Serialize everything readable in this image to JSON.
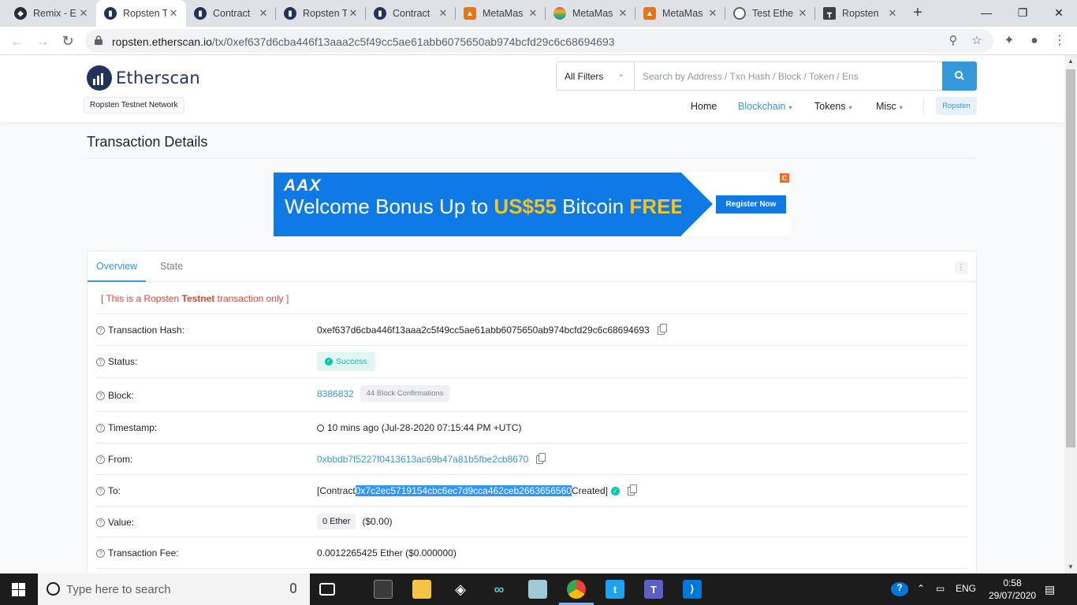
{
  "browser": {
    "tabs": [
      {
        "title": "Remix - E",
        "icon": "remix-icon",
        "color": "#2b2b2b"
      },
      {
        "title": "Ropsten T",
        "icon": "etherscan-icon",
        "color": "#21325b"
      },
      {
        "title": "Contract",
        "icon": "etherscan-icon",
        "color": "#21325b"
      },
      {
        "title": "Ropsten T",
        "icon": "etherscan-icon",
        "color": "#21325b"
      },
      {
        "title": "Contract",
        "icon": "etherscan-icon",
        "color": "#21325b"
      },
      {
        "title": "MetaMas",
        "icon": "metamask-icon",
        "color": "#e2761b"
      },
      {
        "title": "MetaMas",
        "icon": "rainbow-icon",
        "color": "#e04b4b"
      },
      {
        "title": "MetaMas",
        "icon": "metamask-icon",
        "color": "#e2761b"
      },
      {
        "title": "Test Ethe",
        "icon": "globe-icon",
        "color": "#5f6368"
      },
      {
        "title": "Ropsten",
        "icon": "faucet-icon",
        "color": "#3c4043"
      }
    ],
    "active_tab": 1,
    "url_host": "ropsten.etherscan.io",
    "url_path": "/tx/0xef637d6cba446f13aaa2c5f49cc5ae61abb6075650ab974bcfd29c6c68694693"
  },
  "site": {
    "logo_text": "Etherscan",
    "network_badge": "Ropsten Testnet Network",
    "search_filter": "All Filters",
    "search_placeholder": "Search by Address / Txn Hash / Block / Token / Ens",
    "nav": [
      "Home",
      "Blockchain",
      "Tokens",
      "Misc"
    ],
    "network_button": "Ropsten",
    "accent_color": "#3498db"
  },
  "page": {
    "title": "Transaction Details"
  },
  "ad": {
    "brand": "AAX",
    "headline_pre": "Welcome Bonus Up to ",
    "headline_amount": "US$55",
    "headline_mid": " Bitcoin ",
    "headline_free": "FREE",
    "cta": "Register Now",
    "corner": "C"
  },
  "card": {
    "tabs": [
      "Overview",
      "State"
    ],
    "notice_pre": "[ This is a Ropsten ",
    "notice_bold": "Testnet",
    "notice_post": " transaction only ]",
    "labels": {
      "hash": "Transaction Hash:",
      "status": "Status:",
      "block": "Block:",
      "timestamp": "Timestamp:",
      "from": "From:",
      "to": "To:",
      "value": "Value:",
      "fee": "Transaction Fee:"
    },
    "values": {
      "hash": "0xef637d6cba446f13aaa2c5f49cc5ae61abb6075650ab974bcfd29c6c68694693",
      "status": "Success",
      "block": "8386832",
      "confirmations": "44 Block Confirmations",
      "timestamp": "10 mins ago (Jul-28-2020 07:15:44 PM +UTC)",
      "from": "0xbbdb7f5227f0413613ac69b47a81b5fbe2cb8670",
      "to_pre": "[Contract ",
      "to_address": "0x7c2ec5719154cbc6ec7d9cca462ceb2663656560",
      "to_post": " Created]",
      "value_ether": "0 Ether",
      "value_usd": "($0.00)",
      "fee": "0.0012265425 Ether ($0.000000)"
    }
  },
  "taskbar": {
    "search_placeholder": "Type here to search",
    "language": "ENG",
    "time": "0:58",
    "date": "29/07/2020"
  }
}
